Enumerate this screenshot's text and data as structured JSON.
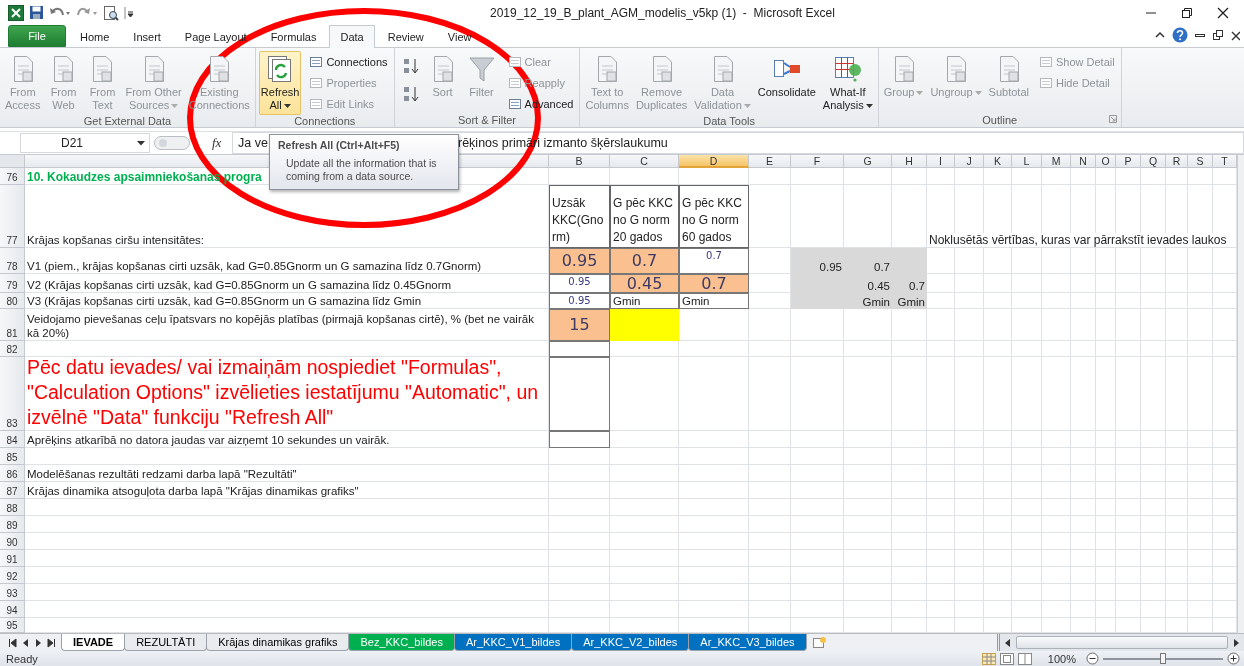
{
  "window": {
    "title": "2019_12_19_B_plant_AGM_modelis_v5kp (1)  -  Microsoft Excel"
  },
  "ribbon_tabs": [
    {
      "label": "File",
      "kind": "file",
      "selected": false
    },
    {
      "label": "Home",
      "kind": "tab",
      "selected": false
    },
    {
      "label": "Insert",
      "kind": "tab",
      "selected": false
    },
    {
      "label": "Page Layout",
      "kind": "tab",
      "selected": false
    },
    {
      "label": "Formulas",
      "kind": "tab",
      "selected": false
    },
    {
      "label": "Data",
      "kind": "tab",
      "selected": true
    },
    {
      "label": "Review",
      "kind": "tab",
      "selected": false
    },
    {
      "label": "View",
      "kind": "tab",
      "selected": false
    }
  ],
  "ribbon_groups": [
    {
      "label": "Get External Data",
      "buttons": [
        {
          "kind": "large",
          "label": "From\nAccess",
          "disabled": true,
          "dropdown": false,
          "hovered": false
        },
        {
          "kind": "large",
          "label": "From\nWeb",
          "disabled": true,
          "dropdown": false,
          "hovered": false
        },
        {
          "kind": "large",
          "label": "From\nText",
          "disabled": true,
          "dropdown": false,
          "hovered": false
        },
        {
          "kind": "large",
          "label": "From Other\nSources",
          "disabled": true,
          "dropdown": true,
          "hovered": false
        },
        {
          "kind": "large",
          "label": "Existing\nConnections",
          "disabled": true,
          "dropdown": false,
          "hovered": false
        }
      ]
    },
    {
      "label": "Connections",
      "buttons": [
        {
          "kind": "large",
          "label": "Refresh\nAll",
          "disabled": false,
          "dropdown": true,
          "hovered": true
        },
        {
          "kind": "stack",
          "items": [
            {
              "label": "Connections",
              "disabled": false
            },
            {
              "label": "Properties",
              "disabled": true
            },
            {
              "label": "Edit Links",
              "disabled": true
            }
          ]
        }
      ]
    },
    {
      "label": "Sort & Filter",
      "buttons": [
        {
          "kind": "sort-pair"
        },
        {
          "kind": "large",
          "label": "Sort",
          "disabled": true,
          "dropdown": false,
          "hovered": false
        },
        {
          "kind": "large",
          "label": "Filter",
          "disabled": true,
          "dropdown": false,
          "hovered": false
        },
        {
          "kind": "stack",
          "items": [
            {
              "label": "Clear",
              "disabled": true
            },
            {
              "label": "Reapply",
              "disabled": true
            },
            {
              "label": "Advanced",
              "disabled": false
            }
          ]
        }
      ]
    },
    {
      "label": "Data Tools",
      "buttons": [
        {
          "kind": "large",
          "label": "Text to\nColumns",
          "disabled": true,
          "dropdown": false,
          "hovered": false
        },
        {
          "kind": "large",
          "label": "Remove\nDuplicates",
          "disabled": true,
          "dropdown": false,
          "hovered": false
        },
        {
          "kind": "large",
          "label": "Data\nValidation",
          "disabled": true,
          "dropdown": true,
          "hovered": false
        },
        {
          "kind": "large",
          "label": "Consolidate",
          "disabled": false,
          "dropdown": false,
          "hovered": false
        },
        {
          "kind": "large",
          "label": "What-If\nAnalysis",
          "disabled": false,
          "dropdown": true,
          "hovered": false
        }
      ]
    },
    {
      "label": "Outline",
      "launcher": true,
      "buttons": [
        {
          "kind": "large",
          "label": "Group",
          "disabled": true,
          "dropdown": true,
          "hovered": false
        },
        {
          "kind": "large",
          "label": "Ungroup",
          "disabled": true,
          "dropdown": true,
          "hovered": false
        },
        {
          "kind": "large",
          "label": "Subtotal",
          "disabled": true,
          "dropdown": false,
          "hovered": false
        },
        {
          "kind": "stack",
          "items": [
            {
              "label": "Show Detail",
              "disabled": true
            },
            {
              "label": "Hide Detail",
              "disabled": true
            }
          ]
        }
      ]
    }
  ],
  "tooltip": {
    "title": "Refresh All (Ctrl+Alt+F5)",
    "text": "Update all the information that is coming from a data source."
  },
  "annotations": [
    {
      "kind": "ellipse",
      "color": "#ff0000"
    }
  ],
  "formula_bar": {
    "name_box": "D21",
    "function_label": "fx",
    "formula_fragments": [
      "Ja ve",
      "rēķinos primāri izmanto šķērslaukumu"
    ]
  },
  "columns": [
    {
      "selected": false
    },
    {
      "label": "B",
      "selected": false
    },
    {
      "label": "C",
      "selected": false
    },
    {
      "label": "D",
      "selected": true
    },
    {
      "label": "E",
      "selected": false
    },
    {
      "label": "F",
      "selected": false
    },
    {
      "label": "G",
      "selected": false
    },
    {
      "label": "H",
      "selected": false
    },
    {
      "label": "I",
      "selected": false
    },
    {
      "label": "J",
      "selected": false
    },
    {
      "label": "K",
      "selected": false
    },
    {
      "label": "L",
      "selected": false
    },
    {
      "label": "M",
      "selected": false
    },
    {
      "label": "N",
      "selected": false
    },
    {
      "label": "O",
      "selected": false
    },
    {
      "label": "P",
      "selected": false
    },
    {
      "label": "Q",
      "selected": false
    },
    {
      "label": "R",
      "selected": false
    },
    {
      "label": "S",
      "selected": false
    },
    {
      "label": "T",
      "selected": false
    }
  ],
  "rows": [
    {
      "number": "76",
      "cells": {
        "A": {
          "kind": "heading",
          "text": "10. Kokaudzes apsaimniekošanas progra"
        }
      }
    },
    {
      "number": "77",
      "cells": {
        "A": {
          "kind": "text",
          "text": "Krājas kopšanas ciršu intensitātes:"
        },
        "B": {
          "kind": "wrap",
          "text": "Uzsāk KKC(Gnorm)"
        },
        "C": {
          "kind": "wrap",
          "text": "G pēc KKC no G norm 20 gados"
        },
        "D": {
          "kind": "wrap",
          "text": "G pēc KKC no G norm 60 gados"
        },
        "I": {
          "kind": "overflow",
          "text": "Noklusētās vērtības, kuras var pārrakstīt ievades laukos"
        }
      }
    },
    {
      "number": "78",
      "cells": {
        "A": {
          "kind": "text",
          "text": "V1 (piem., krājas kopšanas cirti uzsāk, kad G=0.85Gnorm un G samazina līdz 0.7Gnorm)"
        },
        "B": {
          "kind": "input",
          "text": "0.95"
        },
        "C": {
          "kind": "input",
          "text": "0.7"
        },
        "D": {
          "kind": "small",
          "text": "0.7"
        },
        "F": {
          "kind": "shade",
          "text": "0.95"
        },
        "G": {
          "kind": "shade",
          "text": "0.7"
        },
        "H": {
          "kind": "shade"
        }
      }
    },
    {
      "number": "79",
      "cells": {
        "A": {
          "kind": "text",
          "text": "V2 (Krājas kopšanas cirti uzsāk, kad G=0.85Gnorm un G samazina līdz 0.45Gnorm"
        },
        "B": {
          "kind": "small",
          "text": "0.95"
        },
        "C": {
          "kind": "input",
          "text": "0.45"
        },
        "D": {
          "kind": "input",
          "text": "0.7"
        },
        "F": {
          "kind": "shade"
        },
        "G": {
          "kind": "shade",
          "text": "0.45"
        },
        "H": {
          "kind": "shade",
          "text": "0.7"
        }
      }
    },
    {
      "number": "80",
      "cells": {
        "A": {
          "kind": "text",
          "text": "V3 (Krājas kopšanas cirti uzsāk, kad G=0.85Gnorm un G samazina līdz Gmin"
        },
        "B": {
          "kind": "small",
          "text": "0.95"
        },
        "C": {
          "kind": "boxed",
          "text": "Gmin"
        },
        "D": {
          "kind": "boxed",
          "text": "Gmin"
        },
        "F": {
          "kind": "shade"
        },
        "G": {
          "kind": "shade",
          "text": "Gmin"
        },
        "H": {
          "kind": "shade",
          "text": "Gmin"
        }
      }
    },
    {
      "number": "81",
      "cells": {
        "A": {
          "kind": "text",
          "text": "Veidojamo pievešanas ceļu īpatsvars no kopējās platības (pirmajā kopšanas cirtē), % (bet ne vairāk kā 20%)"
        },
        "B": {
          "kind": "input",
          "text": "15"
        },
        "C": {
          "kind": "fill"
        }
      }
    },
    {
      "number": "82",
      "cells": {
        "B": {
          "kind": "boxed"
        }
      }
    },
    {
      "number": "83",
      "cells": {
        "A": {
          "kind": "note",
          "text": "Pēc datu ievades/ vai izmaiņām nospiediet  \"Formulas\", \"Calculation Options\" izvēlieties  iestatījumu \"Automatic\", un izvēlnē \"Data\" funkciju \"Refresh All\""
        },
        "B": {
          "kind": "boxed"
        }
      }
    },
    {
      "number": "84",
      "cells": {
        "A": {
          "kind": "text",
          "text": "Aprēķins atkarībā no datora jaudas var aizņemt 10 sekundes un vairāk."
        },
        "B": {
          "kind": "boxed"
        }
      }
    },
    {
      "number": "85"
    },
    {
      "number": "86",
      "cells": {
        "A": {
          "kind": "text",
          "text": "Modelēšanas rezultāti redzami darba lapā \"Rezultāti\""
        }
      }
    },
    {
      "number": "87",
      "cells": {
        "A": {
          "kind": "text",
          "text": "Krājas dinamika atsoguļota darba lapā \"Krājas dinamikas grafiks\""
        }
      }
    },
    {
      "number": "88"
    },
    {
      "number": "89"
    },
    {
      "number": "90"
    },
    {
      "number": "91"
    },
    {
      "number": "92"
    },
    {
      "number": "93"
    },
    {
      "number": "94"
    },
    {
      "number": "95"
    }
  ],
  "sheet_tabs": [
    {
      "label": "IEVADE",
      "selected": true
    },
    {
      "label": "REZULTĀTI",
      "selected": false
    },
    {
      "label": "Krājas dinamikas grafiks",
      "selected": false
    },
    {
      "label": "Bez_KKC_bildes",
      "selected": false,
      "color": "#00b050"
    },
    {
      "label": "Ar_KKC_V1_bildes",
      "selected": false,
      "color": "#0070c0"
    },
    {
      "label": "Ar_KKC_V2_bildes",
      "selected": false,
      "color": "#0070c0"
    },
    {
      "label": "Ar_KKC_V3_bildes",
      "selected": false,
      "color": "#0070c0"
    }
  ],
  "status_bar": {
    "text": "Ready",
    "zoom": {
      "reading": "100%",
      "level": 0.5
    }
  }
}
